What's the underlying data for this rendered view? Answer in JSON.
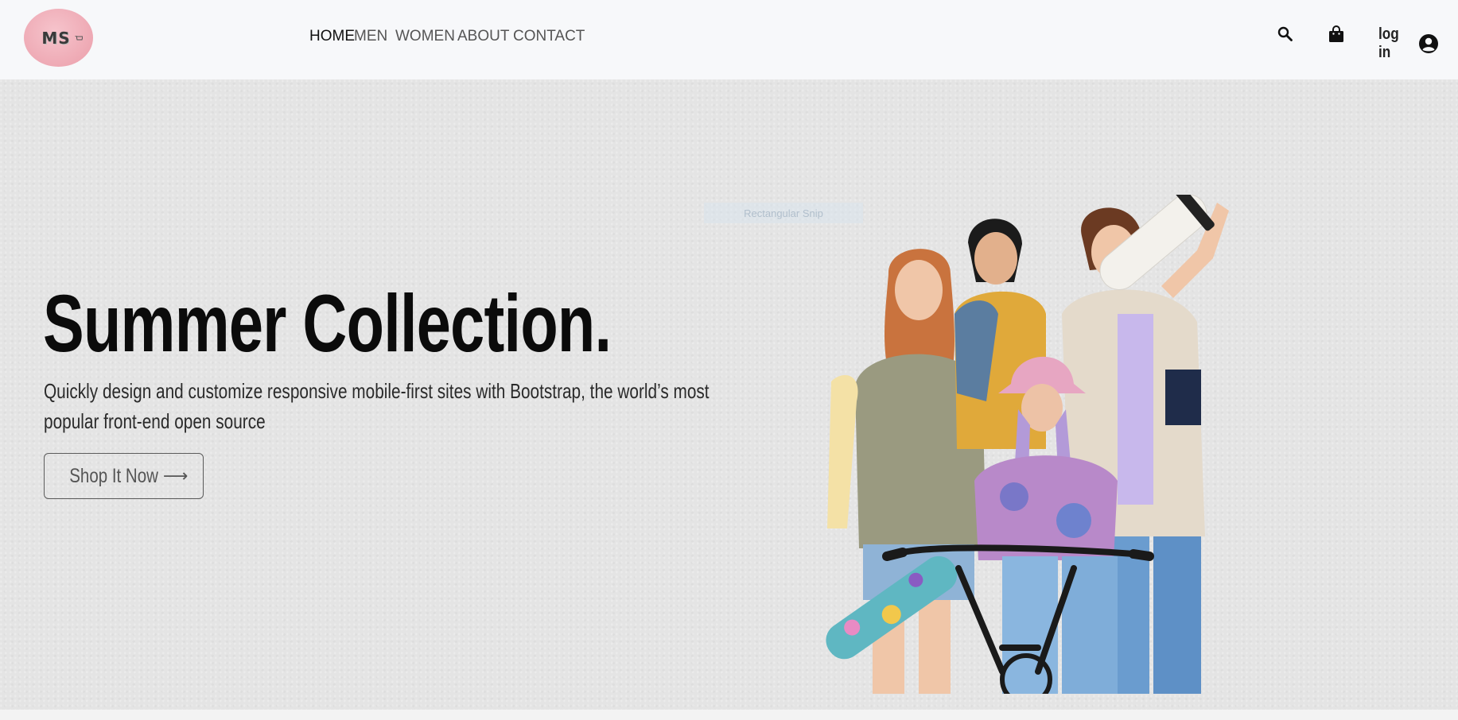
{
  "brand": {
    "logo_text": "MS"
  },
  "nav": {
    "items": [
      {
        "label": "HOME",
        "active": true
      },
      {
        "label": "MEN",
        "active": false
      },
      {
        "label": "WOMEN",
        "active": false
      },
      {
        "label": "ABOUT",
        "active": false
      },
      {
        "label": "CONTACT",
        "active": false
      }
    ],
    "login_label": "log in",
    "icons": [
      "search-icon",
      "shopping-bag-icon",
      "user-circle-icon"
    ]
  },
  "hero": {
    "title": "Summer Collection.",
    "subtitle_line1": "Quickly design and customize responsive mobile-first sites with Bootstrap, the world’s most",
    "subtitle_line2": "popular front-end open source",
    "cta_label": "Shop It Now",
    "cta_arrow": "⟶",
    "faint_label": "Rectangular Snip",
    "image": "group of four young people with skateboards and a bicycle"
  },
  "colors": {
    "navbar_bg": "#f7f8fa",
    "hero_bg": "#e4e4e4",
    "logo_pink": "#eea9b4",
    "title_text": "#0b0b0b"
  }
}
